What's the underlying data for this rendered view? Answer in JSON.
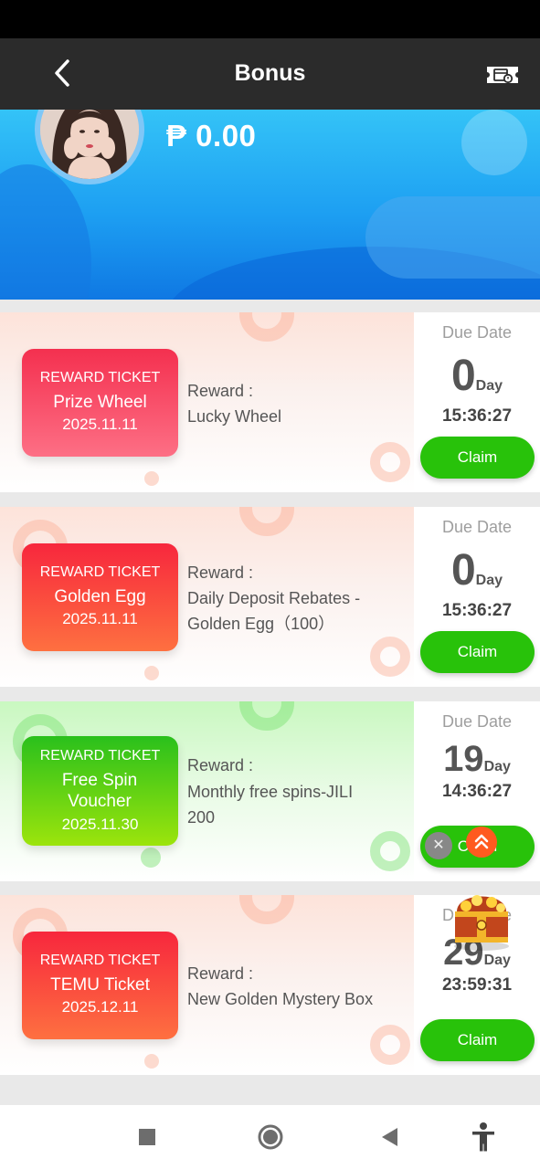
{
  "header": {
    "title": "Bonus"
  },
  "icons": {
    "back": "chevron-left-icon",
    "ticket": "ticket-icon"
  },
  "user": {
    "balance": "₱ 0.00"
  },
  "colors": {
    "header_bg": "#2b2b2b",
    "claim_green": "#28c20a",
    "banner_blue": "#1d9ff2"
  },
  "tickets": [
    {
      "kind": "REWARD TICKET",
      "name": "Prize Wheel",
      "date": "2025.11.11",
      "reward_label": "Reward :",
      "reward_text": "Lucky Wheel",
      "due_label": "Due Date",
      "due_days": "0",
      "day_unit": "Day",
      "due_time": "15:36:27",
      "claim_label": "Claim"
    },
    {
      "kind": "REWARD TICKET",
      "name": "Golden Egg",
      "date": "2025.11.11",
      "reward_label": "Reward :",
      "reward_text": "Daily Deposit Rebates - Golden Egg（100）",
      "due_label": "Due Date",
      "due_days": "0",
      "day_unit": "Day",
      "due_time": "15:36:27",
      "claim_label": "Claim"
    },
    {
      "kind": "REWARD TICKET",
      "name": "Free Spin Voucher",
      "date": "2025.11.30",
      "reward_label": "Reward :",
      "reward_text": "Monthly free spins-JILI 200",
      "due_label": "Due Date",
      "due_days": "19",
      "day_unit": "Day",
      "due_time": "14:36:27",
      "claim_label": "Claim"
    },
    {
      "kind": "REWARD TICKET",
      "name": "TEMU Ticket",
      "date": "2025.12.11",
      "reward_label": "Reward :",
      "reward_text": "New Golden Mystery Box",
      "due_label": "Due Date",
      "due_days": "29",
      "day_unit": "Day",
      "due_time": "23:59:31",
      "claim_label": "Claim"
    }
  ],
  "floating": {
    "close_symbol": "✕"
  }
}
